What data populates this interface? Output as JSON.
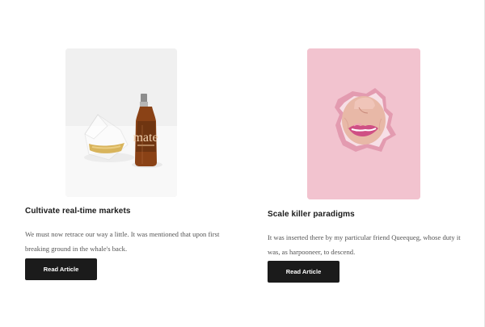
{
  "articles": [
    {
      "image_icon": "bottle-and-glass-photo",
      "title": "Cultivate real-time markets",
      "excerpt": "We must now retrace our way a little. It was mentioned that upon first breaking ground in the whale's back.",
      "button_label": "Read Article"
    },
    {
      "image_icon": "lips-through-paper-photo",
      "title": "Scale killer paradigms",
      "excerpt": "It was inserted there by my particular friend Queequeg, whose duty it was, as harpooneer, to descend.",
      "button_label": "Read Article"
    }
  ],
  "colors": {
    "button_bg": "#1b1b1b",
    "button_text": "#ffffff",
    "title_text": "#1a1a1a",
    "excerpt_text": "#555555",
    "left_image_bg": "#f0f0f0",
    "right_image_bg": "#f2c3cf"
  }
}
